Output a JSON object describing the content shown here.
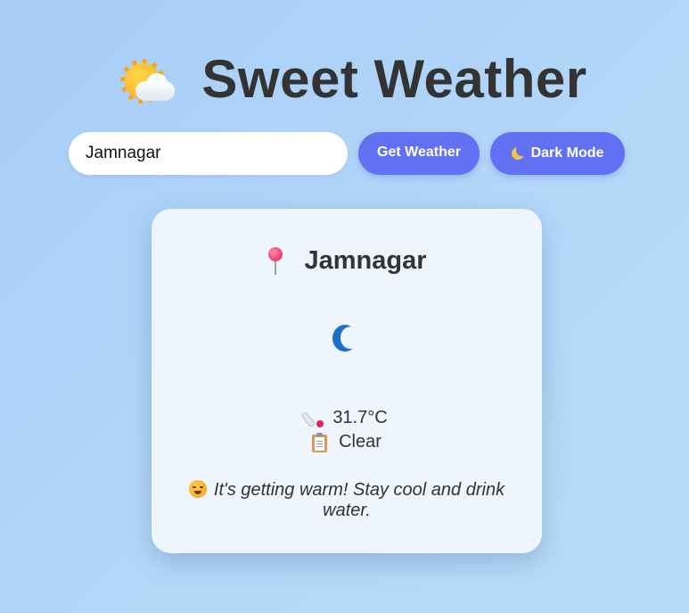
{
  "header": {
    "logo_icon": "sun-behind-cloud-icon",
    "title": "Sweet Weather"
  },
  "search": {
    "value": "Jamnagar",
    "placeholder": "",
    "get_weather_label": "Get Weather",
    "dark_mode_icon": "crescent-moon-icon",
    "dark_mode_label": "Dark Mode"
  },
  "card": {
    "city_icon": "pin-icon",
    "city": "Jamnagar",
    "weather_icon": "crescent-moon-icon",
    "temperature_icon": "thermometer-icon",
    "temperature": "31.7°C",
    "condition_icon": "clipboard-icon",
    "condition": "Clear",
    "advice_icon": "hot-face-icon",
    "advice": "It's getting warm! Stay cool and drink water."
  },
  "colors": {
    "accent": "#6270f2",
    "background": "#b4d8f8",
    "card": "#eef5fd",
    "text": "#333333",
    "weather_icon": "#1e6fc9"
  }
}
